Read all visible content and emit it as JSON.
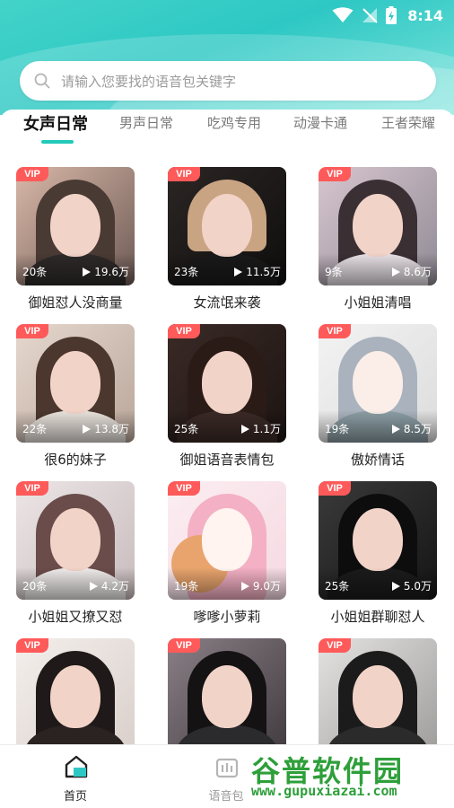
{
  "status_bar": {
    "time": "8:14"
  },
  "search": {
    "placeholder": "请输入您要找的语音包关键字"
  },
  "tabs": [
    {
      "label": "女声日常",
      "active": true
    },
    {
      "label": "男声日常",
      "active": false
    },
    {
      "label": "吃鸡专用",
      "active": false
    },
    {
      "label": "动漫卡通",
      "active": false
    },
    {
      "label": "王者荣耀",
      "active": false
    }
  ],
  "cards": [
    {
      "title": "御姐怼人没商量",
      "badge": "VIP",
      "count": "20条",
      "plays": "19.6万"
    },
    {
      "title": "女流氓来袭",
      "badge": "VIP",
      "count": "23条",
      "plays": "11.5万"
    },
    {
      "title": "小姐姐清唱",
      "badge": "VIP",
      "count": "9条",
      "plays": "8.6万"
    },
    {
      "title": "很6的妹子",
      "badge": "VIP",
      "count": "22条",
      "plays": "13.8万"
    },
    {
      "title": "御姐语音表情包",
      "badge": "VIP",
      "count": "25条",
      "plays": "1.1万"
    },
    {
      "title": "傲娇情话",
      "badge": "VIP",
      "count": "19条",
      "plays": "8.5万"
    },
    {
      "title": "小姐姐又撩又怼",
      "badge": "VIP",
      "count": "20条",
      "plays": "4.2万"
    },
    {
      "title": "嗲嗲小萝莉",
      "badge": "VIP",
      "count": "19条",
      "plays": "9.0万"
    },
    {
      "title": "小姐姐群聊怼人",
      "badge": "VIP",
      "count": "25条",
      "plays": "5.0万"
    },
    {
      "title": "",
      "badge": "VIP",
      "count": "",
      "plays": ""
    },
    {
      "title": "",
      "badge": "VIP",
      "count": "",
      "plays": ""
    },
    {
      "title": "",
      "badge": "VIP",
      "count": "",
      "plays": ""
    }
  ],
  "bottom_nav": [
    {
      "label": "首页",
      "icon": "home-icon",
      "active": true
    },
    {
      "label": "语音包",
      "icon": "voice-pack-icon",
      "active": false
    }
  ],
  "watermark": {
    "logo": "谷普软件园",
    "url": "www.gupuxiazai.com"
  },
  "colors": {
    "accent": "#23c9b9",
    "header": "#2ec8c4",
    "vip_badge": "#ff5a5a",
    "watermark": "#2e9f3a"
  }
}
